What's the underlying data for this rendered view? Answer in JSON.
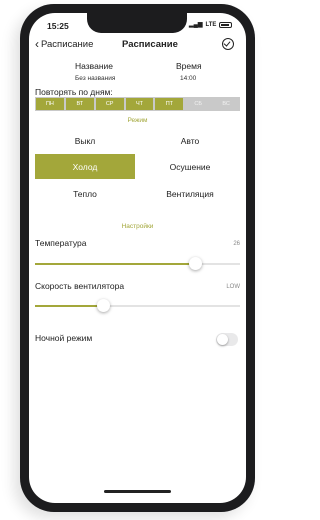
{
  "status": {
    "time": "15:25",
    "network": "LTE"
  },
  "nav": {
    "back_label": "Расписание",
    "title": "Расписание"
  },
  "schedule": {
    "name_label": "Название",
    "name_value": "Без названия",
    "time_label": "Время",
    "time_value": "14:00"
  },
  "repeat": {
    "label": "Повторять по дням:",
    "days": [
      {
        "label": "ПН",
        "on": true
      },
      {
        "label": "ВТ",
        "on": true
      },
      {
        "label": "СР",
        "on": true
      },
      {
        "label": "ЧТ",
        "on": true
      },
      {
        "label": "ПТ",
        "on": true
      },
      {
        "label": "СБ",
        "on": false
      },
      {
        "label": "ВС",
        "on": false
      }
    ]
  },
  "mode": {
    "title": "Режим",
    "options": [
      "Выкл",
      "Авто",
      "Холод",
      "Осушение",
      "Тепло",
      "Вентиляция"
    ],
    "selected": "Холод"
  },
  "settings": {
    "title": "Настройки",
    "temperature": {
      "label": "Температура",
      "value": "26",
      "level": 0.78
    },
    "fan_speed": {
      "label": "Скорость вентилятора",
      "value": "LOW",
      "level": 0.33
    },
    "night_mode": {
      "label": "Ночной режим",
      "on": false
    }
  },
  "colors": {
    "accent": "#a3a73a"
  }
}
